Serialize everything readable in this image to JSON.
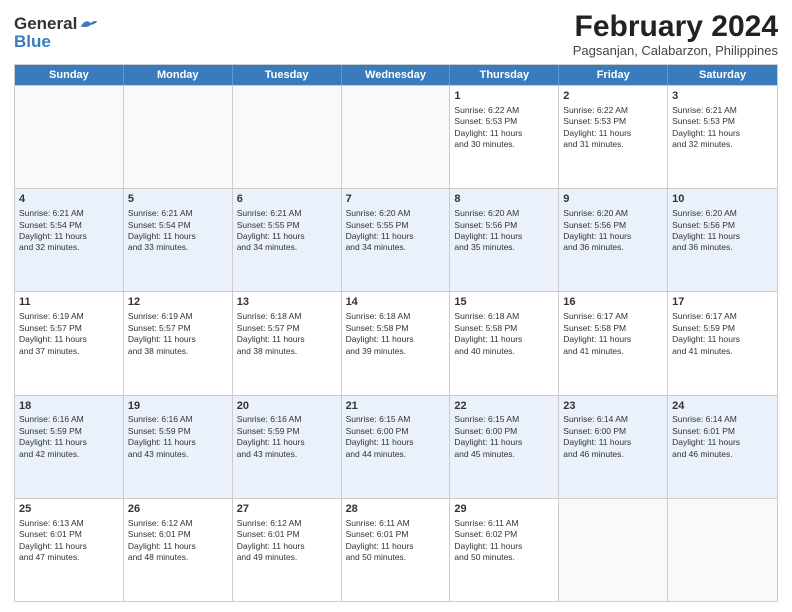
{
  "header": {
    "logo_general": "General",
    "logo_blue": "Blue",
    "title": "February 2024",
    "subtitle": "Pagsanjan, Calabarzon, Philippines"
  },
  "days": [
    "Sunday",
    "Monday",
    "Tuesday",
    "Wednesday",
    "Thursday",
    "Friday",
    "Saturday"
  ],
  "rows": [
    [
      {
        "day": "",
        "info": ""
      },
      {
        "day": "",
        "info": ""
      },
      {
        "day": "",
        "info": ""
      },
      {
        "day": "",
        "info": ""
      },
      {
        "day": "1",
        "info": "Sunrise: 6:22 AM\nSunset: 5:53 PM\nDaylight: 11 hours\nand 30 minutes."
      },
      {
        "day": "2",
        "info": "Sunrise: 6:22 AM\nSunset: 5:53 PM\nDaylight: 11 hours\nand 31 minutes."
      },
      {
        "day": "3",
        "info": "Sunrise: 6:21 AM\nSunset: 5:53 PM\nDaylight: 11 hours\nand 32 minutes."
      }
    ],
    [
      {
        "day": "4",
        "info": "Sunrise: 6:21 AM\nSunset: 5:54 PM\nDaylight: 11 hours\nand 32 minutes."
      },
      {
        "day": "5",
        "info": "Sunrise: 6:21 AM\nSunset: 5:54 PM\nDaylight: 11 hours\nand 33 minutes."
      },
      {
        "day": "6",
        "info": "Sunrise: 6:21 AM\nSunset: 5:55 PM\nDaylight: 11 hours\nand 34 minutes."
      },
      {
        "day": "7",
        "info": "Sunrise: 6:20 AM\nSunset: 5:55 PM\nDaylight: 11 hours\nand 34 minutes."
      },
      {
        "day": "8",
        "info": "Sunrise: 6:20 AM\nSunset: 5:56 PM\nDaylight: 11 hours\nand 35 minutes."
      },
      {
        "day": "9",
        "info": "Sunrise: 6:20 AM\nSunset: 5:56 PM\nDaylight: 11 hours\nand 36 minutes."
      },
      {
        "day": "10",
        "info": "Sunrise: 6:20 AM\nSunset: 5:56 PM\nDaylight: 11 hours\nand 36 minutes."
      }
    ],
    [
      {
        "day": "11",
        "info": "Sunrise: 6:19 AM\nSunset: 5:57 PM\nDaylight: 11 hours\nand 37 minutes."
      },
      {
        "day": "12",
        "info": "Sunrise: 6:19 AM\nSunset: 5:57 PM\nDaylight: 11 hours\nand 38 minutes."
      },
      {
        "day": "13",
        "info": "Sunrise: 6:18 AM\nSunset: 5:57 PM\nDaylight: 11 hours\nand 38 minutes."
      },
      {
        "day": "14",
        "info": "Sunrise: 6:18 AM\nSunset: 5:58 PM\nDaylight: 11 hours\nand 39 minutes."
      },
      {
        "day": "15",
        "info": "Sunrise: 6:18 AM\nSunset: 5:58 PM\nDaylight: 11 hours\nand 40 minutes."
      },
      {
        "day": "16",
        "info": "Sunrise: 6:17 AM\nSunset: 5:58 PM\nDaylight: 11 hours\nand 41 minutes."
      },
      {
        "day": "17",
        "info": "Sunrise: 6:17 AM\nSunset: 5:59 PM\nDaylight: 11 hours\nand 41 minutes."
      }
    ],
    [
      {
        "day": "18",
        "info": "Sunrise: 6:16 AM\nSunset: 5:59 PM\nDaylight: 11 hours\nand 42 minutes."
      },
      {
        "day": "19",
        "info": "Sunrise: 6:16 AM\nSunset: 5:59 PM\nDaylight: 11 hours\nand 43 minutes."
      },
      {
        "day": "20",
        "info": "Sunrise: 6:16 AM\nSunset: 5:59 PM\nDaylight: 11 hours\nand 43 minutes."
      },
      {
        "day": "21",
        "info": "Sunrise: 6:15 AM\nSunset: 6:00 PM\nDaylight: 11 hours\nand 44 minutes."
      },
      {
        "day": "22",
        "info": "Sunrise: 6:15 AM\nSunset: 6:00 PM\nDaylight: 11 hours\nand 45 minutes."
      },
      {
        "day": "23",
        "info": "Sunrise: 6:14 AM\nSunset: 6:00 PM\nDaylight: 11 hours\nand 46 minutes."
      },
      {
        "day": "24",
        "info": "Sunrise: 6:14 AM\nSunset: 6:01 PM\nDaylight: 11 hours\nand 46 minutes."
      }
    ],
    [
      {
        "day": "25",
        "info": "Sunrise: 6:13 AM\nSunset: 6:01 PM\nDaylight: 11 hours\nand 47 minutes."
      },
      {
        "day": "26",
        "info": "Sunrise: 6:12 AM\nSunset: 6:01 PM\nDaylight: 11 hours\nand 48 minutes."
      },
      {
        "day": "27",
        "info": "Sunrise: 6:12 AM\nSunset: 6:01 PM\nDaylight: 11 hours\nand 49 minutes."
      },
      {
        "day": "28",
        "info": "Sunrise: 6:11 AM\nSunset: 6:01 PM\nDaylight: 11 hours\nand 50 minutes."
      },
      {
        "day": "29",
        "info": "Sunrise: 6:11 AM\nSunset: 6:02 PM\nDaylight: 11 hours\nand 50 minutes."
      },
      {
        "day": "",
        "info": ""
      },
      {
        "day": "",
        "info": ""
      }
    ]
  ]
}
